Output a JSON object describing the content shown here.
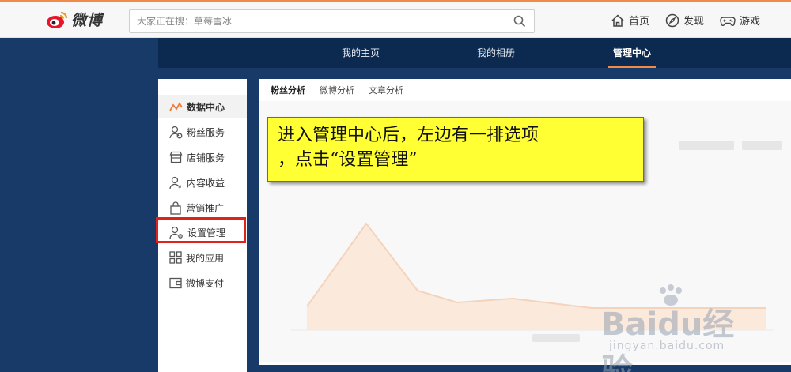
{
  "header": {
    "logo_text": "微博",
    "search_placeholder": "大家正在搜：草莓雪冰",
    "nav": [
      {
        "label": "首页",
        "icon": "home-icon"
      },
      {
        "label": "发现",
        "icon": "compass-icon"
      },
      {
        "label": "游戏",
        "icon": "gamepad-icon"
      }
    ]
  },
  "subnav": {
    "items": [
      {
        "label": "我的主页",
        "active": false
      },
      {
        "label": "我的相册",
        "active": false
      },
      {
        "label": "管理中心",
        "active": true
      }
    ]
  },
  "sidebar": {
    "items": [
      {
        "label": "数据中心",
        "icon": "trend-icon",
        "active": true
      },
      {
        "label": "粉丝服务",
        "icon": "fans-icon"
      },
      {
        "label": "店铺服务",
        "icon": "shop-icon"
      },
      {
        "label": "内容收益",
        "icon": "income-icon"
      },
      {
        "label": "营销推广",
        "icon": "bag-icon"
      },
      {
        "label": "设置管理",
        "icon": "user-gear-icon",
        "highlighted": true
      },
      {
        "label": "我的应用",
        "icon": "apps-grid-icon"
      },
      {
        "label": "微博支付",
        "icon": "wallet-icon"
      }
    ]
  },
  "main": {
    "tabs": [
      {
        "label": "粉丝分析",
        "active": true
      },
      {
        "label": "微博分析",
        "active": false
      },
      {
        "label": "文章分析",
        "active": false
      }
    ]
  },
  "annotation": {
    "line1": "进入管理中心后，左边有一排选项",
    "line2": "，点击“设置管理”"
  },
  "watermark": {
    "main": "Baidu经验",
    "sub": "jingyan.baidu.com"
  },
  "colors": {
    "accent_orange": "#f08a4b",
    "dark_blue": "#0c2a4f",
    "highlight_red": "#e0221a",
    "annotation_yellow": "#ffff33"
  }
}
